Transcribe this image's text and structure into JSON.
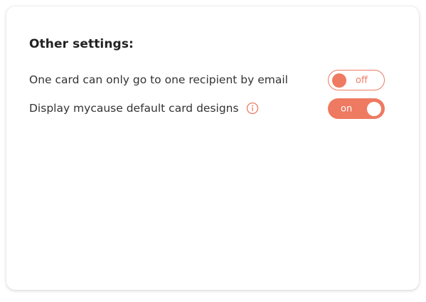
{
  "settings_panel": {
    "title": "Other settings:",
    "rows": [
      {
        "label": "One card can only go to one recipient by email",
        "toggle_state": "off",
        "toggle_text": "off",
        "has_info_icon": false
      },
      {
        "label": "Display mycause default card designs",
        "toggle_state": "on",
        "toggle_text": "on",
        "has_info_icon": true,
        "info_icon": "info-circle-icon"
      }
    ]
  },
  "colors": {
    "accent": "#ee7a61",
    "text": "#333333",
    "title": "#222222"
  }
}
